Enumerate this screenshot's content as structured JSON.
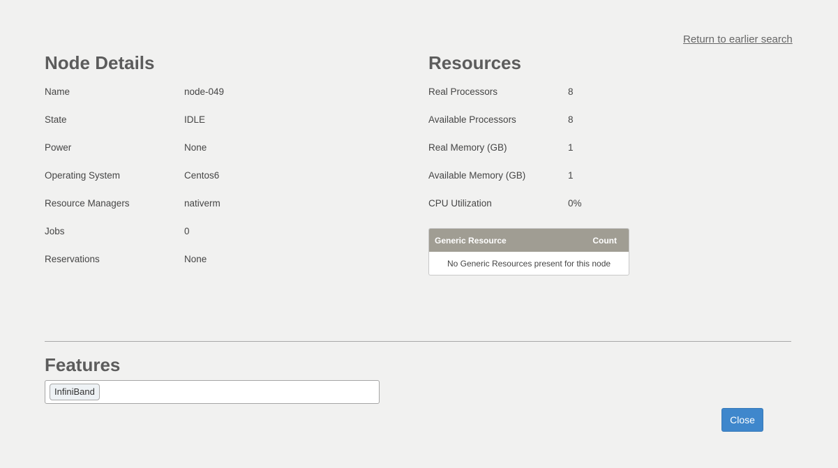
{
  "return_link": "Return to earlier search",
  "node_details": {
    "title": "Node Details",
    "rows": [
      {
        "label": "Name",
        "value": "node-049"
      },
      {
        "label": "State",
        "value": "IDLE"
      },
      {
        "label": "Power",
        "value": "None"
      },
      {
        "label": "Operating System",
        "value": "Centos6"
      },
      {
        "label": "Resource Managers",
        "value": "nativerm"
      },
      {
        "label": "Jobs",
        "value": "0"
      },
      {
        "label": "Reservations",
        "value": "None"
      }
    ]
  },
  "resources": {
    "title": "Resources",
    "rows": [
      {
        "label": "Real Processors",
        "value": "8"
      },
      {
        "label": "Available Processors",
        "value": "8"
      },
      {
        "label": "Real Memory (GB)",
        "value": "1"
      },
      {
        "label": "Available Memory (GB)",
        "value": "1"
      },
      {
        "label": "CPU Utilization",
        "value": "0%"
      }
    ],
    "generic_table": {
      "headers": [
        "Generic Resource",
        "Count"
      ],
      "empty_message": "No Generic Resources present for this node"
    }
  },
  "features": {
    "title": "Features",
    "tags": [
      "InfiniBand"
    ]
  },
  "close_label": "Close"
}
